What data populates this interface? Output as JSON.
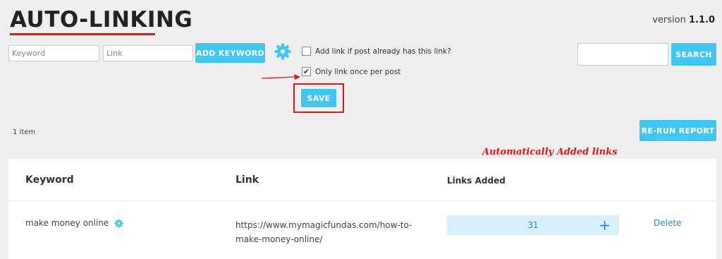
{
  "header": {
    "title": "AUTO-LINKING",
    "version_label": "version",
    "version_number": "1.1.0"
  },
  "form": {
    "keyword_placeholder": "Keyword",
    "link_placeholder": "Link",
    "add_keyword_label": "ADD KEYWORD",
    "option_add_link_label": "Add link if post already has this link?",
    "option_add_link_checked": false,
    "option_once_label": "Only link once per post",
    "option_once_checked": true,
    "option_once_mark": "✔",
    "save_label": "SAVE"
  },
  "search": {
    "placeholder": "",
    "button_label": "SEARCH"
  },
  "rerun_label": "RE-RUN REPORT",
  "item_count": "1 item",
  "annotation": "Automatically Added links",
  "table": {
    "headers": {
      "keyword": "Keyword",
      "link": "Link",
      "links_added": "Links Added"
    },
    "rows": [
      {
        "keyword": "make money online",
        "link_line1": "https://www.mymagicfundas.com/how-to-",
        "link_line2": "make-money-online/",
        "links_added": "31",
        "plus": "+",
        "delete_label": "Delete"
      }
    ]
  },
  "colors": {
    "accent": "#40c6f2",
    "annotation_red": "#e0161b",
    "link_blue": "#2a85c8"
  }
}
